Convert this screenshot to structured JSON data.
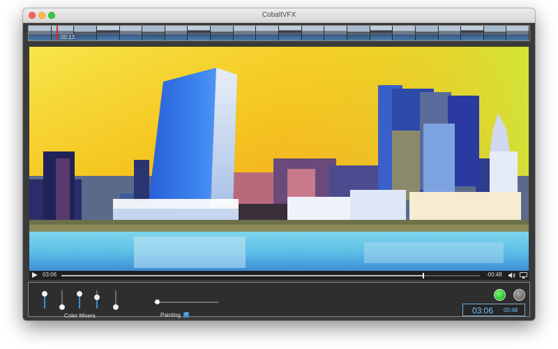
{
  "window": {
    "title": "CobaltVFX"
  },
  "filmstrip": {
    "playhead_time": "00:13",
    "frame_count": 22
  },
  "player": {
    "current_time": "03:06",
    "remaining_time": "-00:48",
    "progress": 0.865
  },
  "controls": {
    "color_mixers_label": "Color Mixers",
    "mixers": [
      0.88,
      0.0,
      0.88,
      0.62,
      0.0
    ],
    "painting_slider": 0.03,
    "painting_label": "Painting",
    "painting_checked": true,
    "timecode_main": "03:06",
    "timecode_remaining": "00:48"
  },
  "colors": {
    "accent": "#3b8fd6",
    "record": "#1fc224",
    "timecode": "#6fc4ff"
  }
}
